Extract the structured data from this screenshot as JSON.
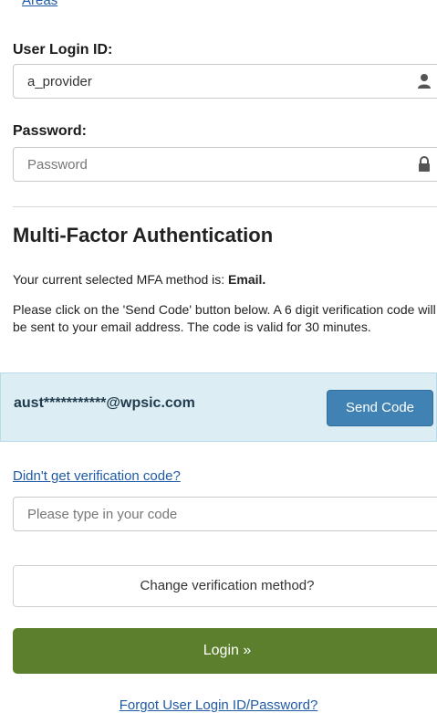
{
  "top_link": "Areas",
  "user_login": {
    "label": "User Login ID:",
    "value": "a_provider",
    "icon": "user-icon"
  },
  "password": {
    "label": "Password:",
    "placeholder": "Password",
    "icon": "lock-icon"
  },
  "mfa": {
    "title": "Multi-Factor Authentication",
    "current_method_prefix": "Your current selected MFA method is: ",
    "current_method": "Email.",
    "instructions": "Please click on the 'Send Code' button below. A 6 digit verification code will be sent to your email address. The code is valid for 30 minutes.",
    "masked_email": "aust***********@wpsic.com",
    "send_code_label": "Send Code",
    "didnt_get_code_link": "Didn't get verification code?",
    "code_placeholder": "Please type in your code",
    "change_method_label": "Change verification method?"
  },
  "login_button_label": "Login »",
  "forgot_link": "Forgot User Login ID/Password?",
  "colors": {
    "link": "#1f5aa6",
    "login_button": "#5b7f2c",
    "send_button": "#3f82b3",
    "email_panel": "#dcedf3"
  }
}
